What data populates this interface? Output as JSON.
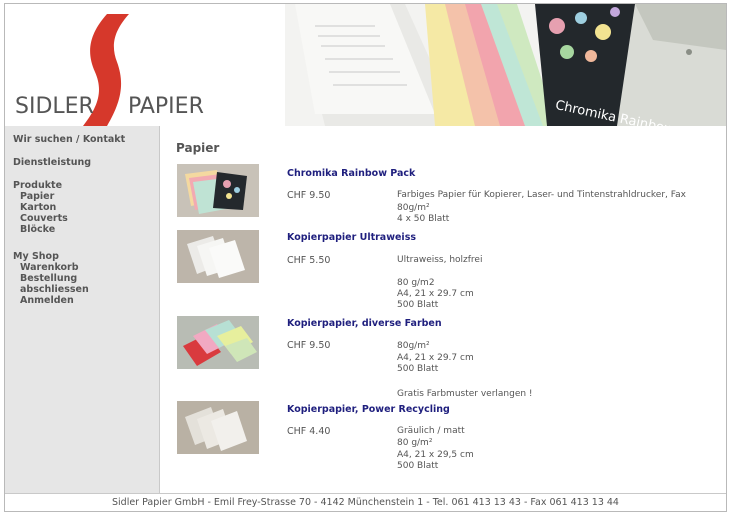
{
  "logo": {
    "left": "SIDLER",
    "right": "PAPIER"
  },
  "banner": {
    "text": "Chromika Rainbow"
  },
  "sidebar": {
    "contact": "Wir suchen / Kontakt",
    "service": "Dienstleistung",
    "products": "Produkte",
    "product_items": [
      "Papier",
      "Karton",
      "Couverts",
      "Blöcke"
    ],
    "shop": "My Shop",
    "shop_items": [
      "Warenkorb",
      "Bestellung",
      "abschliessen",
      "Anmelden"
    ]
  },
  "main": {
    "title": "Papier",
    "products": [
      {
        "name": "Chromika Rainbow Pack",
        "price": "CHF 9.50",
        "desc": [
          "Farbiges Papier für Kopierer, Laser- und Tintenstrahldrucker, Fax",
          "80g/m²",
          "4 x 50 Blatt"
        ]
      },
      {
        "name": "Kopierpapier Ultraweiss",
        "price": "CHF 5.50",
        "desc": [
          "Ultraweiss, holzfrei",
          "",
          "80 g/m2",
          "A4, 21 x 29.7 cm",
          "500 Blatt"
        ]
      },
      {
        "name": "Kopierpapier, diverse Farben",
        "price": "CHF 9.50",
        "desc": [
          "80g/m²",
          "A4, 21 x 29.7 cm",
          "500 Blatt",
          "",
          "Gratis Farbmuster verlangen !"
        ]
      },
      {
        "name": "Kopierpapier, Power Recycling",
        "price": "CHF 4.40",
        "desc": [
          "Gräulich / matt",
          "80 g/m²",
          "A4, 21 x 29,5 cm",
          "500 Blatt"
        ]
      }
    ]
  },
  "footer": {
    "text": "Sidler Papier GmbH - Emil Frey-Strasse 70 - 4142 Münchenstein 1 - Tel. 061 413 13 43 - Fax 061 413 13 44"
  },
  "colors": {
    "logo_red": "#d6382b",
    "link_blue": "#1f1f7e",
    "sidebar_bg": "#e6e6e6",
    "text_gray": "#555555"
  }
}
